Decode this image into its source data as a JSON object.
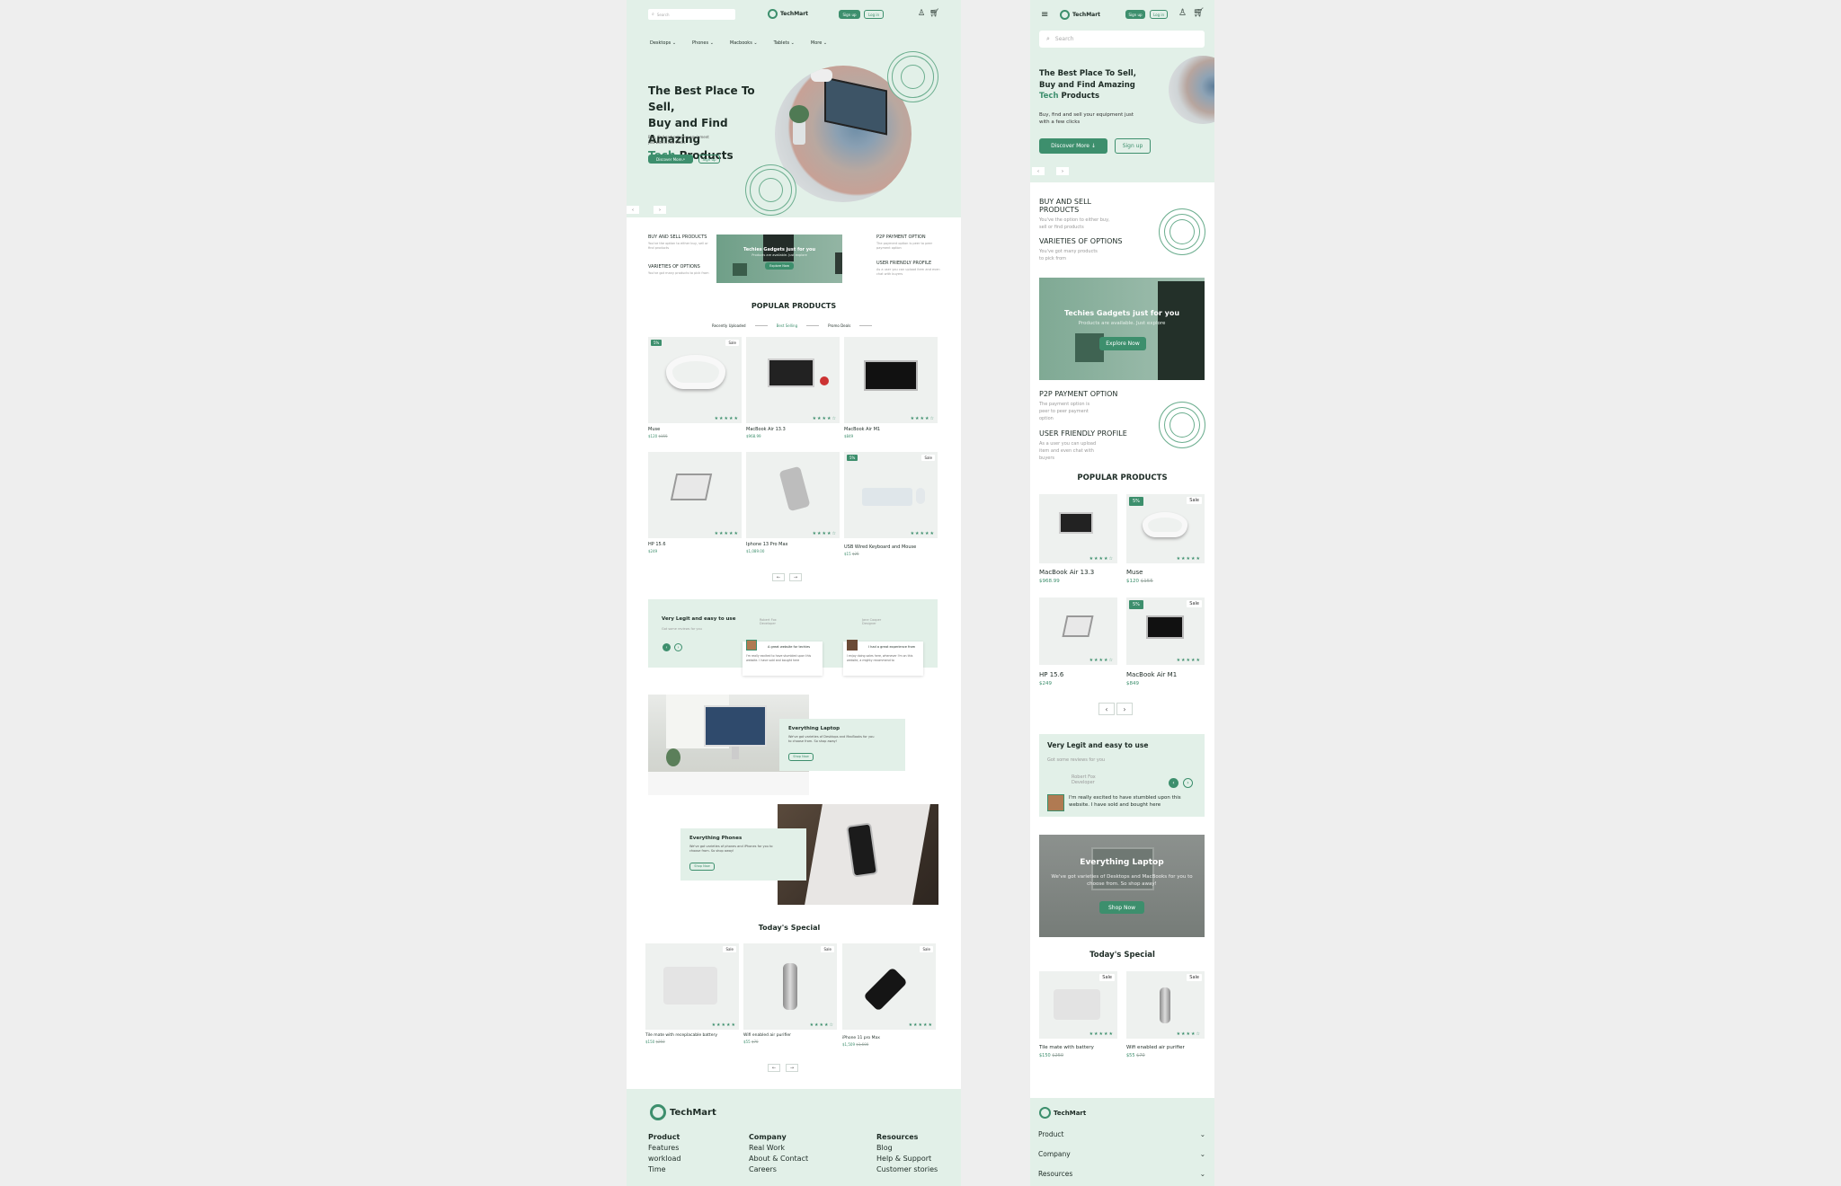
{
  "brand": "TechMart",
  "search": {
    "placeholder": "Search"
  },
  "auth": {
    "signup": "Sign up",
    "login": "Log in"
  },
  "nav": [
    "Desktops",
    "Phones",
    "Macbooks",
    "Tablets",
    "More"
  ],
  "hero": {
    "l1": "The Best Place To Sell,",
    "l2": "Buy and Find Amazing",
    "accent": "Tech",
    "l3rest": " Products",
    "sub": "Buy, find and sell your equipment just with a few clicks",
    "discover": "Discover More",
    "signup": "Sign up"
  },
  "features": [
    {
      "title": "BUY AND SELL PRODUCTS",
      "desc": "You've the option to either buy, sell or find products"
    },
    {
      "title": "VARIETIES OF OPTIONS",
      "desc": "You've got many products to pick from"
    },
    {
      "title": "P2P PAYMENT OPTION",
      "desc": "The payment option is peer to peer payment option"
    },
    {
      "title": "USER FRIENDLY PROFILE",
      "desc": "As a user you can upload item and even chat with buyers"
    }
  ],
  "promo": {
    "title": "Techies Gadgets just for you",
    "sub": "Products are available. Just explore",
    "btn": "Explore Now"
  },
  "popular": {
    "title": "POPULAR PRODUCTS",
    "tabs": [
      "Recently Uploaded",
      "Best Selling",
      "Promo Deals"
    ]
  },
  "products": [
    {
      "name": "Muse",
      "price": "$120",
      "old": "$155",
      "badge": "5%",
      "sale": "Sale",
      "stars": "★★★★★"
    },
    {
      "name": "MacBook Air 13.3",
      "price": "$968.99",
      "old": "",
      "badge": "",
      "sale": "",
      "stars": "★★★★☆"
    },
    {
      "name": "MacBook Air M1",
      "price": "$849",
      "old": "",
      "badge": "",
      "sale": "",
      "stars": "★★★★☆"
    },
    {
      "name": "HP 15.6",
      "price": "$249",
      "old": "",
      "badge": "",
      "sale": "",
      "stars": "★★★★★"
    },
    {
      "name": "Iphone 13 Pro Max",
      "price": "$1,089.00",
      "old": "",
      "badge": "",
      "sale": "",
      "stars": "★★★★☆"
    },
    {
      "name": "USB Wired Keyboard and Mouse",
      "price": "$15",
      "old": "$25",
      "badge": "5%",
      "sale": "Sale",
      "stars": "★★★★★"
    }
  ],
  "testimonials": {
    "title": "Very Legit and easy to use",
    "sub": "Got some reviews for you",
    "r1": {
      "name": "Robert Fox",
      "role": "Developer",
      "head": "A great website for techies",
      "body": "I'm really excited to have stumbled upon this website. I have sold and bought here"
    },
    "r2": {
      "name": "Jane Cooper",
      "role": "Designer",
      "head": "I had a great experience from",
      "body": "I enjoy doing sales here, whenever I'm on this website, a mighty recommend to"
    }
  },
  "laptops": {
    "title": "Everything Laptop",
    "desc": "We've got varieties of Desktops and MacBooks for you to choose from. So shop away!",
    "btn": "Shop Now"
  },
  "phones": {
    "title": "Everything Phones",
    "desc": "We've got varieties of phones and iPhones for you to choose from. So shop away!",
    "btn": "Shop Now"
  },
  "special": {
    "title": "Today's Special"
  },
  "specials": [
    {
      "name": "Tile mate with receplacable battery",
      "price": "$150",
      "old": "$250",
      "sale": "Sale"
    },
    {
      "name": "Wifi enabled air purifier",
      "price": "$55",
      "old": "$70",
      "sale": "Sale"
    },
    {
      "name": "iPhone 11 pro Max",
      "price": "$1,509",
      "old": "$1,600",
      "sale": "Sale"
    }
  ],
  "footer": {
    "cols": [
      {
        "h": "Product",
        "items": [
          "Features",
          "workload",
          "Time"
        ]
      },
      {
        "h": "Company",
        "items": [
          "Real Work",
          "About & Contact",
          "Careers"
        ]
      },
      {
        "h": "Resources",
        "items": [
          "Blog",
          "Help & Support",
          "Customer stories"
        ]
      }
    ]
  },
  "mobile": {
    "products": [
      {
        "name": "MacBook Air 13.3",
        "price": "$968.99",
        "old": "",
        "badge": "",
        "sale": ""
      },
      {
        "name": "Muse",
        "price": "$120",
        "old": "$155",
        "badge": "5%",
        "sale": "Sale"
      },
      {
        "name": "HP 15.6",
        "price": "$249",
        "old": "",
        "badge": "",
        "sale": ""
      },
      {
        "name": "MacBook Air M1",
        "price": "$849",
        "old": "",
        "badge": "5%",
        "sale": "Sale"
      }
    ],
    "review": {
      "name": "Robert Fox",
      "role": "Developer",
      "body": "I'm really excited to have stumbled upon this website. I have sold and bought here"
    },
    "specials": [
      {
        "name": "Tile mate with battery",
        "price": "$150",
        "old": "$250",
        "sale": "Sale"
      },
      {
        "name": "Wifi enabled air purifier",
        "price": "$55",
        "old": "$70",
        "sale": "Sale"
      }
    ],
    "footer": [
      "Product",
      "Company",
      "Resources"
    ]
  }
}
